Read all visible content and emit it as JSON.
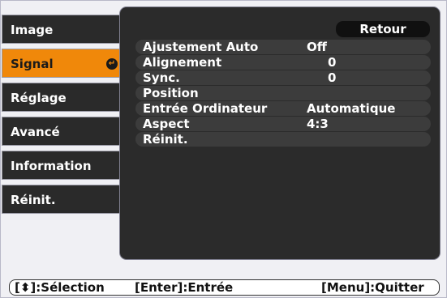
{
  "sidebar": {
    "items": [
      {
        "label": "Image",
        "selected": false
      },
      {
        "label": "Signal",
        "selected": true
      },
      {
        "label": "Réglage",
        "selected": false
      },
      {
        "label": "Avancé",
        "selected": false
      },
      {
        "label": "Information",
        "selected": false
      },
      {
        "label": "Réinit.",
        "selected": false
      }
    ]
  },
  "panel": {
    "retour_label": "Retour",
    "rows": [
      {
        "label": "Ajustement Auto",
        "value": "Off"
      },
      {
        "label": "Alignement",
        "value": "0"
      },
      {
        "label": "Sync.",
        "value": "0"
      },
      {
        "label": "Position",
        "value": ""
      },
      {
        "label": "Entrée Ordinateur",
        "value": "Automatique"
      },
      {
        "label": "Aspect",
        "value": "4:3"
      },
      {
        "label": "Réinit.",
        "value": ""
      }
    ]
  },
  "statusbar": {
    "selection": "[⬍]:Sélection",
    "enter": "[Enter]:Entrée",
    "quit": "[Menu]:Quitter"
  },
  "colors": {
    "accent": "#f0880a",
    "panel": "#2b2b2b",
    "tab": "#2a2a2a"
  }
}
